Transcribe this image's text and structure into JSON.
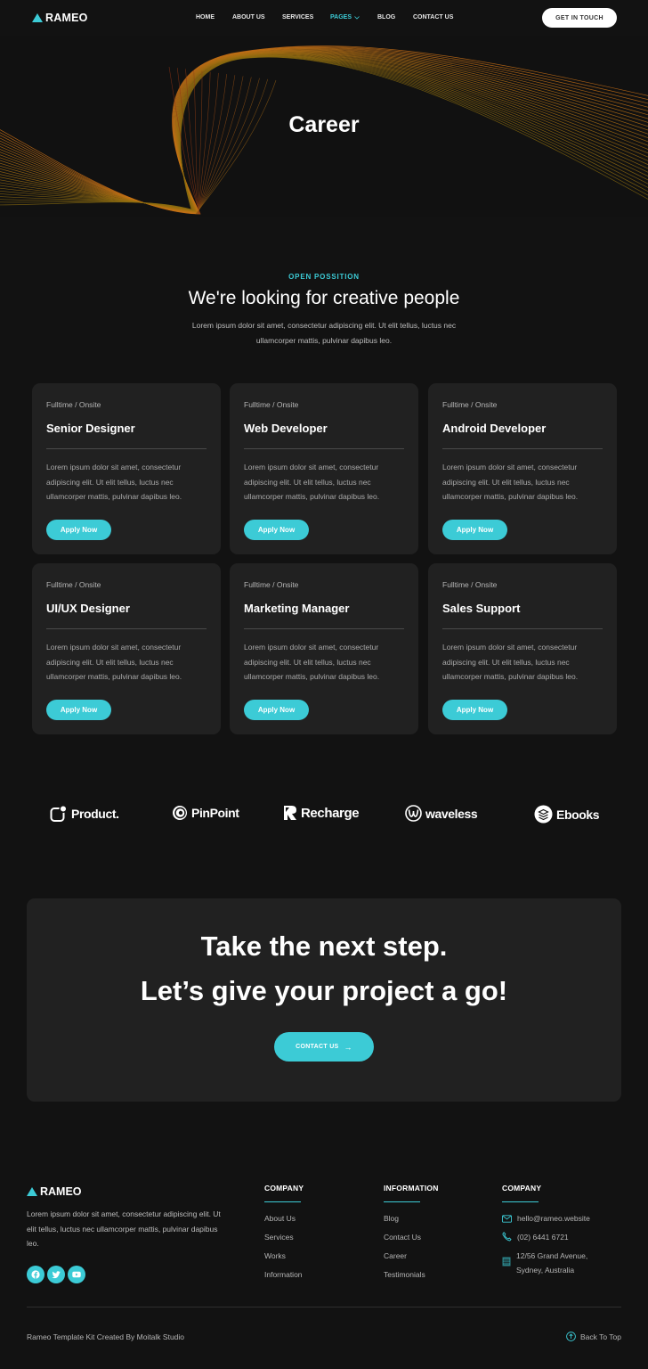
{
  "brand": {
    "name": "RAMEO",
    "accent": "#3ccbd6"
  },
  "nav": {
    "items": [
      {
        "label": "HOME"
      },
      {
        "label": "ABOUT US"
      },
      {
        "label": "SERVICES"
      },
      {
        "label": "PAGES",
        "active": true,
        "has_dropdown": true
      },
      {
        "label": "BLOG"
      },
      {
        "label": "CONTACT US"
      }
    ],
    "cta_label": "GET IN TOUCH"
  },
  "hero": {
    "title": "Career"
  },
  "intro": {
    "eyebrow": "OPEN POSSITION",
    "heading": "We're looking for creative people",
    "text": "Lorem ipsum dolor sit amet, consectetur adipiscing elit. Ut elit tellus, luctus nec ullamcorper mattis, pulvinar dapibus leo."
  },
  "jobs": [
    {
      "type": "Fulltime / Onsite",
      "title": "Senior Designer",
      "desc": "Lorem ipsum dolor sit amet, consectetur adipiscing elit. Ut elit tellus, luctus nec ullamcorper mattis, pulvinar dapibus leo.",
      "button": "Apply Now"
    },
    {
      "type": "Fulltime / Onsite",
      "title": "Web Developer",
      "desc": "Lorem ipsum dolor sit amet, consectetur adipiscing elit. Ut elit tellus, luctus nec ullamcorper mattis, pulvinar dapibus leo.",
      "button": "Apply Now"
    },
    {
      "type": "Fulltime / Onsite",
      "title": "Android Developer",
      "desc": "Lorem ipsum dolor sit amet, consectetur adipiscing elit. Ut elit tellus, luctus nec ullamcorper mattis, pulvinar dapibus leo.",
      "button": "Apply Now"
    },
    {
      "type": "Fulltime / Onsite",
      "title": "UI/UX Designer",
      "desc": "Lorem ipsum dolor sit amet, consectetur adipiscing elit. Ut elit tellus, luctus nec ullamcorper mattis, pulvinar dapibus leo.",
      "button": "Apply Now"
    },
    {
      "type": "Fulltime / Onsite",
      "title": "Marketing Manager",
      "desc": "Lorem ipsum dolor sit amet, consectetur adipiscing elit. Ut elit tellus, luctus nec ullamcorper mattis, pulvinar dapibus leo.",
      "button": "Apply Now"
    },
    {
      "type": "Fulltime / Onsite",
      "title": "Sales Support",
      "desc": "Lorem ipsum dolor sit amet, consectetur adipiscing elit. Ut elit tellus, luctus nec ullamcorper mattis, pulvinar dapibus leo.",
      "button": "Apply Now"
    }
  ],
  "brands": [
    {
      "name": "Product.",
      "icon": "product-logo-icon"
    },
    {
      "name": "PinPoint",
      "icon": "pinpoint-logo-icon"
    },
    {
      "name": "Recharge",
      "icon": "recharge-logo-icon"
    },
    {
      "name": "waveless",
      "icon": "waveless-logo-icon"
    },
    {
      "name": "Ebooks",
      "icon": "ebooks-logo-icon"
    }
  ],
  "cta": {
    "line1": "Take the next step.",
    "line2": "Let’s give your project a go!",
    "button": "CONTACT US",
    "button_icon": "→"
  },
  "footer": {
    "about": "Lorem ipsum dolor sit amet, consectetur adipiscing elit. Ut elit tellus, luctus nec ullamcorper mattis, pulvinar dapibus leo.",
    "socials": [
      "facebook",
      "twitter",
      "youtube"
    ],
    "col1": {
      "heading": "COMPANY",
      "links": [
        "About Us",
        "Services",
        "Works",
        "Information"
      ]
    },
    "col2": {
      "heading": "INFORMATION",
      "links": [
        "Blog",
        "Contact Us",
        "Career",
        "Testimonials"
      ]
    },
    "col3": {
      "heading": "COMPANY",
      "email": "hello@rameo.website",
      "phone": "(02) 6441 6721",
      "address_line1": "12/56 Grand Avenue,",
      "address_line2": "Sydney, Australia"
    },
    "copyright": "Rameo Template Kit Created By Moitalk Studio",
    "back_to_top": "Back To Top"
  }
}
